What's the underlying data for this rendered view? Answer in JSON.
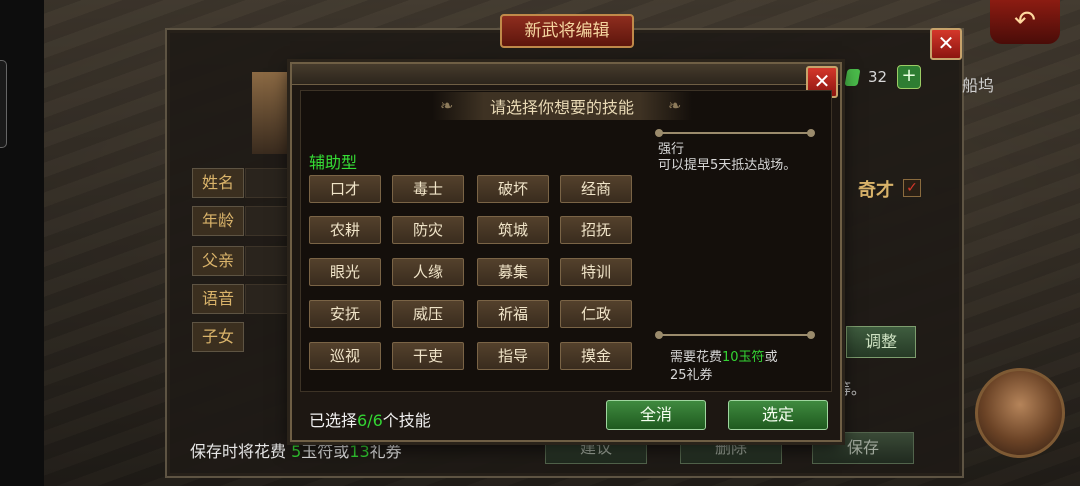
{
  "back_panel": {
    "title": "新武将编辑",
    "close_label": "✕",
    "fields": [
      "姓名",
      "年龄",
      "父亲",
      "语音",
      "子女"
    ],
    "trait": "奇才",
    "trait_check": "✓",
    "coin_count": "32",
    "add_label": "+",
    "side_text": "船坞",
    "adjust_label": "调整",
    "trailing_text": "等。",
    "save_note_prefix": "保存时将花费",
    "save_note_jade": "5",
    "save_note_mid": "玉符或",
    "save_note_coupon": "13",
    "save_note_suffix": "礼券",
    "buttons": {
      "suggest": "建议",
      "delete": "删除",
      "save": "保存"
    },
    "return_icon": "↶"
  },
  "dialog": {
    "title": "请选择你想要的技能",
    "close_label": "✕",
    "category": "辅助型",
    "skills": [
      "口才",
      "毒士",
      "破坏",
      "经商",
      "农耕",
      "防灾",
      "筑城",
      "招抚",
      "眼光",
      "人缘",
      "募集",
      "特训",
      "安抚",
      "威压",
      "祈福",
      "仁政",
      "巡视",
      "干吏",
      "指导",
      "摸金"
    ],
    "desc_title": "强行",
    "desc_body": "可以提早5天抵达战场。",
    "cost_prefix": "需要花费",
    "cost_jade": "10玉符",
    "cost_mid": "或",
    "cost_coupon": "25礼券",
    "selected_prefix": "已选择",
    "selected_count": "6/6",
    "selected_suffix": "个技能",
    "clear_label": "全消",
    "confirm_label": "选定"
  },
  "colors": {
    "accent_green": "#33d433",
    "close_red": "#c62a1e"
  }
}
